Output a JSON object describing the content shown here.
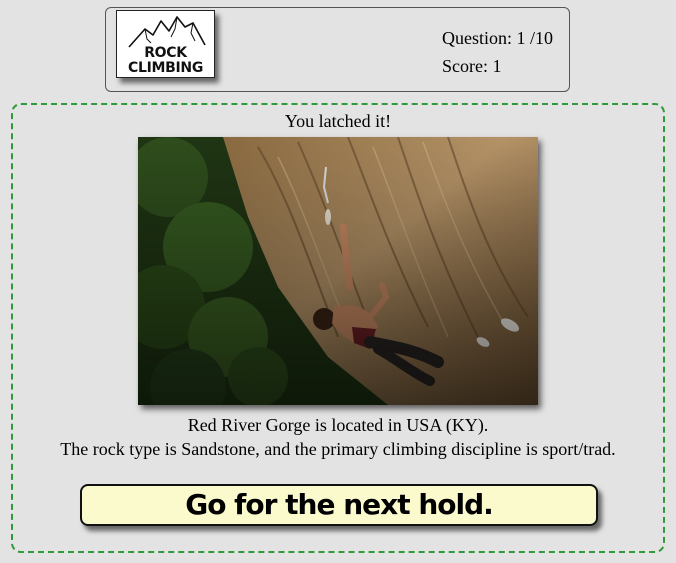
{
  "header": {
    "logo": {
      "line1": "ROCK",
      "line2": "CLIMBING",
      "icon": "mountain-icon"
    },
    "question_label": "Question: 1 /10",
    "score_label": "Score: 1"
  },
  "main": {
    "feedback": "You latched it!",
    "photo": {
      "icon": "climber-photo",
      "description_colors": {
        "foliage": "#2a4a1a",
        "rock": "#a98a5c",
        "shadow": "#1a1a12"
      }
    },
    "info_line1": "Red River Gorge is located in USA (KY).",
    "info_line2": "The rock type is Sandstone, and the primary climbing discipline is sport/trad.",
    "next_button_label": "Go for the next hold."
  },
  "colors": {
    "background": "#e3e3e3",
    "panel_border": "#2f9a3a",
    "button_bg": "#fbfacd"
  }
}
